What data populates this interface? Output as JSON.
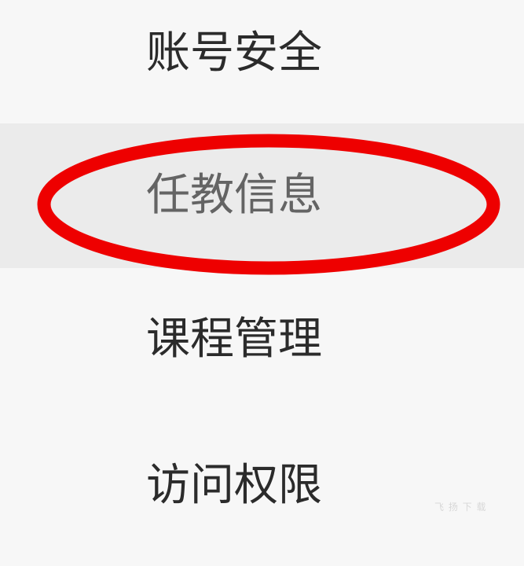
{
  "menu": {
    "items": [
      {
        "label": "账号安全",
        "active": false
      },
      {
        "label": "任教信息",
        "active": true
      },
      {
        "label": "课程管理",
        "active": false
      },
      {
        "label": "访问权限",
        "active": false
      }
    ]
  },
  "annotation": {
    "shape": "ellipse",
    "target": "任教信息",
    "color": "#ee0000"
  },
  "watermark": "飞 扬 下 载",
  "colors": {
    "background": "#f7f7f7",
    "active_background": "#ebebeb",
    "text": "#2b2b2b",
    "active_text": "#646464",
    "highlight": "#ee0000"
  }
}
